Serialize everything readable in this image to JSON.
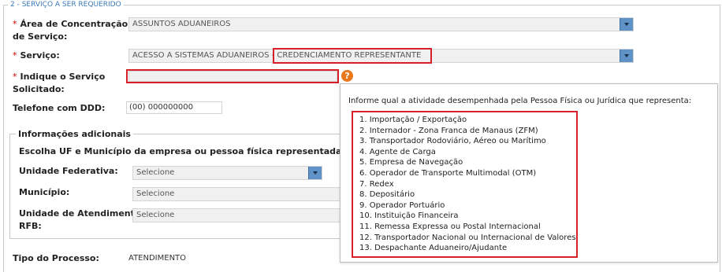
{
  "section": {
    "title": "2 - SERVIÇO A SER REQUERIDO"
  },
  "required_mark": "*",
  "area": {
    "label_line1": "Área de Concentração",
    "label_line2": "de Serviço:",
    "value": "ASSUNTOS ADUANEIROS"
  },
  "servico": {
    "label": "Serviço:",
    "value_prefix": "ACESSO A SISTEMAS ADUANEIROS - ",
    "value_highlight": "CREDENCIAMENTO REPRESENTANTE"
  },
  "indique": {
    "label_line1": "Indique o Serviço",
    "label_line2": "Solicitado:",
    "value": "",
    "help_icon": "question-icon",
    "help_glyph": "?"
  },
  "telefone": {
    "label": "Telefone com DDD:",
    "value": "(00) 000000000"
  },
  "info": {
    "title": "Informações adicionais",
    "instruction": "Escolha UF e Município da empresa ou pessoa física representada. Em segu",
    "uf": {
      "label": "Unidade Federativa:",
      "value": "Selecione"
    },
    "municipio": {
      "label": "Município:",
      "value": "Selecione"
    },
    "unidade": {
      "label_line1": "Unidade de Atendimento",
      "label_line2": "RFB:",
      "value": "Selecione"
    }
  },
  "tipo": {
    "label": "Tipo do Processo:",
    "value": "ATENDIMENTO"
  },
  "tooltip": {
    "intro": "Informe qual a atividade desempenhada pela Pessoa Física ou Jurídica que representa:",
    "items": [
      "1. Importação / Exportação",
      "2. Internador - Zona Franca de Manaus (ZFM)",
      "3. Transportador Rodoviário, Aéreo ou Marítimo",
      "4. Agente de Carga",
      "5. Empresa de Navegação",
      "6. Operador de Transporte Multimodal (OTM)",
      "7. Redex",
      "8. Depositário",
      "9. Operador Portuário",
      "10. Instituição Financeira",
      "11. Remessa Expressa ou Postal Internacional",
      "12. Transportador Nacional ou Internacional de Valores",
      "13. Despachante Aduaneiro/Ajudante"
    ]
  },
  "colors": {
    "accent": "#3a78b5",
    "highlight": "#d6202a",
    "help": "#e9781c",
    "dropdown": "#5f93c8"
  }
}
